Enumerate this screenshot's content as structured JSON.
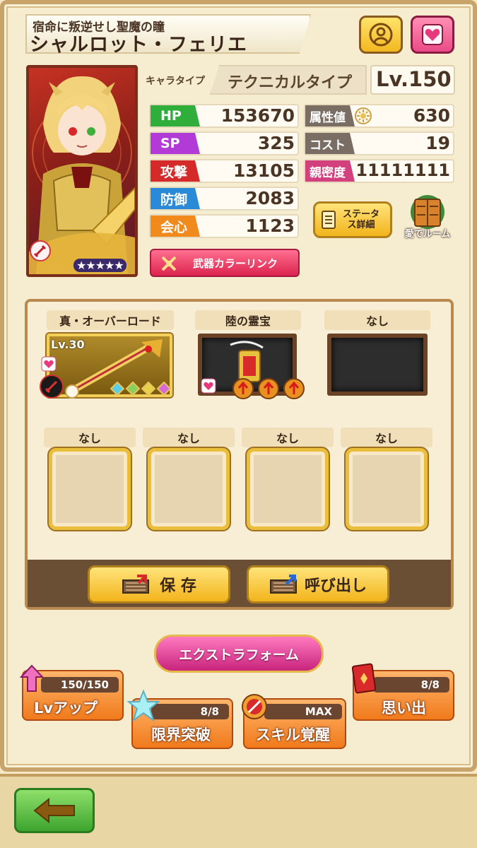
{
  "header": {
    "subtitle": "宿命に叛逆せし聖魔の瞳",
    "name": "シャルロット・フェリエ"
  },
  "character": {
    "type_label": "キャラタイプ",
    "type_value": "テクニカルタイプ",
    "level": "Lv.150",
    "rarity_stars": "★★★★★"
  },
  "stats": {
    "hp": {
      "label": "HP",
      "value": "153670"
    },
    "sp": {
      "label": "SP",
      "value": "325"
    },
    "attack": {
      "label": "攻撃",
      "value": "13105"
    },
    "defense": {
      "label": "防御",
      "value": "2083"
    },
    "critical": {
      "label": "会心",
      "value": "1123"
    },
    "attribute": {
      "label": "属性値",
      "value": "630"
    },
    "cost": {
      "label": "コスト",
      "value": "19"
    },
    "affinity": {
      "label": "親密度",
      "value": "11111111"
    }
  },
  "buttons": {
    "status_detail": "ステータス詳細",
    "love_room": "愛でルーム",
    "weapon_color_link": "武器カラーリンク",
    "save": "保 存",
    "load": "呼び出し",
    "extra_form": "エクストラフォーム"
  },
  "equipment": {
    "main_slots": [
      {
        "label": "真・オーバーロード",
        "level": "Lv.30"
      },
      {
        "label": "陸の霊宝"
      },
      {
        "label": "なし"
      }
    ],
    "sub_slots": [
      {
        "label": "なし"
      },
      {
        "label": "なし"
      },
      {
        "label": "なし"
      },
      {
        "label": "なし"
      }
    ]
  },
  "growth": {
    "level_up": {
      "label": "Lvアップ",
      "progress": "150/150"
    },
    "limit_break": {
      "label": "限界突破",
      "progress": "8/8"
    },
    "skill_awaken": {
      "label": "スキル覚醒",
      "progress": "MAX"
    },
    "memories": {
      "label": "思い出",
      "progress": "8/8"
    }
  },
  "colors": {
    "hp": "#2fae3c",
    "sp": "#b23ad6",
    "attack": "#d42a2a",
    "defense": "#2a8ad8",
    "critical": "#f08a1c",
    "attribute": "#7a6e64",
    "cost": "#7a6e64",
    "affinity": "#d2407e"
  }
}
